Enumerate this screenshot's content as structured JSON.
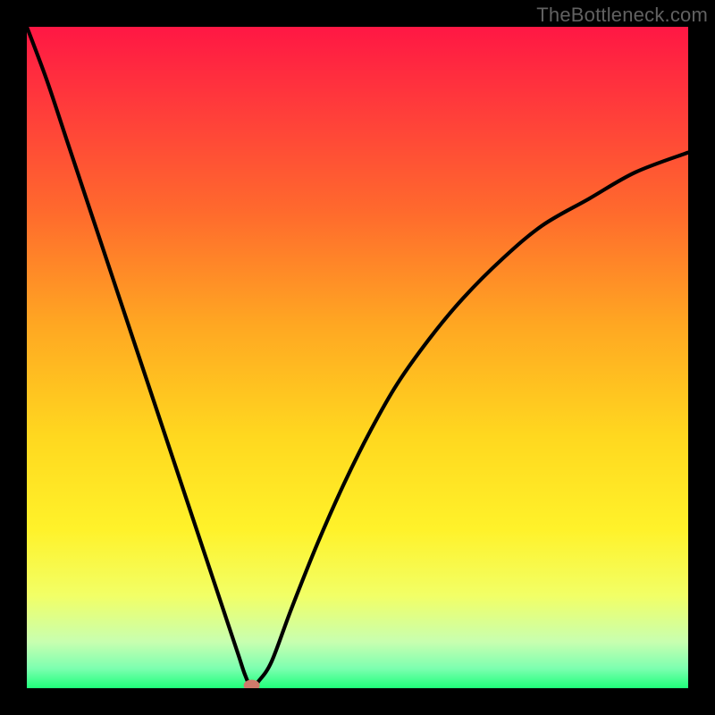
{
  "watermark": "TheBottleneck.com",
  "chart_data": {
    "type": "line",
    "title": "",
    "xlabel": "",
    "ylabel": "",
    "xlim": [
      0,
      100
    ],
    "ylim": [
      0,
      100
    ],
    "grid": false,
    "legend": false,
    "marker": {
      "x": 34,
      "y": 0,
      "color": "#cf7b6b"
    },
    "gradient_stops": [
      {
        "offset": 0.0,
        "color": "#ff1744"
      },
      {
        "offset": 0.12,
        "color": "#ff3b3b"
      },
      {
        "offset": 0.28,
        "color": "#ff6a2d"
      },
      {
        "offset": 0.45,
        "color": "#ffa722"
      },
      {
        "offset": 0.62,
        "color": "#ffd81f"
      },
      {
        "offset": 0.76,
        "color": "#fff22a"
      },
      {
        "offset": 0.86,
        "color": "#f2ff66"
      },
      {
        "offset": 0.93,
        "color": "#c8ffb0"
      },
      {
        "offset": 0.97,
        "color": "#7dffb0"
      },
      {
        "offset": 1.0,
        "color": "#1fff7a"
      }
    ],
    "series": [
      {
        "name": "bottleneck-curve",
        "x": [
          0,
          3,
          6,
          9,
          12,
          15,
          18,
          21,
          24,
          27,
          30,
          32,
          33,
          34,
          35,
          37,
          40,
          44,
          48,
          52,
          56,
          61,
          66,
          72,
          78,
          85,
          92,
          100
        ],
        "y": [
          100,
          92,
          83,
          74,
          65,
          56,
          47,
          38,
          29,
          20,
          11,
          5,
          2,
          0,
          1,
          4,
          12,
          22,
          31,
          39,
          46,
          53,
          59,
          65,
          70,
          74,
          78,
          81
        ]
      }
    ]
  }
}
